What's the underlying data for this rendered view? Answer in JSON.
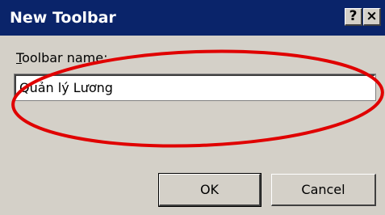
{
  "window": {
    "title": "New Toolbar",
    "help_button": "?",
    "close_button": "×"
  },
  "form": {
    "label_mnemonic": "T",
    "label_rest": "oolbar name:",
    "toolbar_name_value": "Quản lý Lương"
  },
  "buttons": {
    "ok_label": "OK",
    "cancel_label": "Cancel"
  },
  "annotation": {
    "shape": "ellipse",
    "color": "#e00000"
  }
}
